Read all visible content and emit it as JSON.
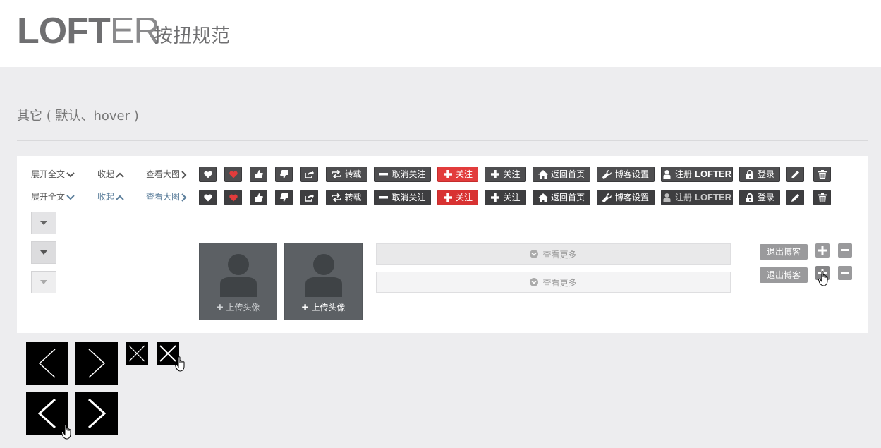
{
  "header": {
    "logo_dark": "LOFT",
    "logo_light": "ER",
    "subtitle": "按扭规范"
  },
  "section": {
    "title": "其它 ( 默认、hover )"
  },
  "links": {
    "expand": "展开全文",
    "collapse": "收起",
    "view_large": "查看大图"
  },
  "buttons": {
    "repost": "转载",
    "unfollow": "取消关注",
    "follow": "关注",
    "back_home": "返回首页",
    "blog_settings": "博客设置",
    "register_prefix": "注册",
    "register_brand": "LOFTER",
    "login": "登录"
  },
  "avatar": {
    "upload_label": "上传头像"
  },
  "more": {
    "label": "查看更多"
  },
  "blog": {
    "quit_label": "退出博客"
  },
  "colors": {
    "dark_button": "#4e4e50",
    "accent_red": "#e23c3c",
    "link_blue": "#5b7e9b",
    "avatar_bg": "#5c6064"
  }
}
